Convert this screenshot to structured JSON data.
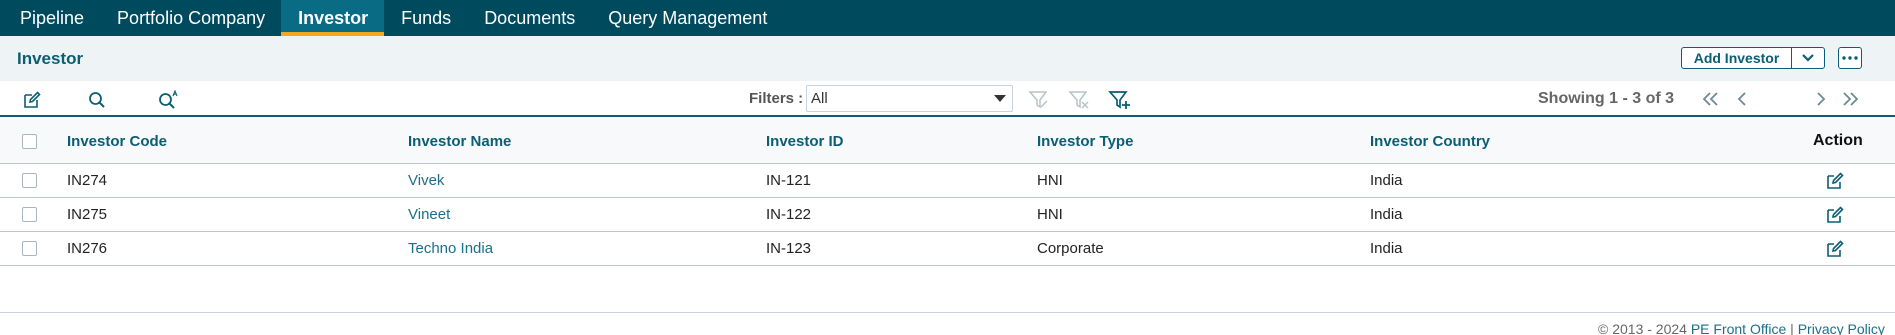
{
  "nav": {
    "items": [
      {
        "label": "Pipeline"
      },
      {
        "label": "Portfolio Company"
      },
      {
        "label": "Investor"
      },
      {
        "label": "Funds"
      },
      {
        "label": "Documents"
      },
      {
        "label": "Query Management"
      }
    ],
    "active": "Investor"
  },
  "header": {
    "title": "Investor",
    "add_label": "Add Investor"
  },
  "toolbar": {
    "filters_label": "Filters :",
    "filter_value": "All",
    "showing": "Showing 1 - 3 of 3"
  },
  "table": {
    "columns": [
      "Investor Code",
      "Investor Name",
      "Investor ID",
      "Investor Type",
      "Investor Country",
      "Action"
    ],
    "rows": [
      {
        "code": "IN274",
        "name": "Vivek",
        "id": "IN-121",
        "type": "HNI",
        "country": "India"
      },
      {
        "code": "IN275",
        "name": "Vineet",
        "id": "IN-122",
        "type": "HNI",
        "country": "India"
      },
      {
        "code": "IN276",
        "name": "Techno India",
        "id": "IN-123",
        "type": "Corporate",
        "country": "India"
      }
    ]
  },
  "footer": {
    "copyright": "© 2013 - 2024",
    "brand": "PE Front Office",
    "separator": "|",
    "privacy": "Privacy Policy"
  },
  "colors": {
    "nav_bg": "#004a5e",
    "nav_active_bg": "#0a6c84",
    "nav_active_underline": "#f5a623",
    "accent": "#0b5e73",
    "link": "#1b6f8a"
  }
}
